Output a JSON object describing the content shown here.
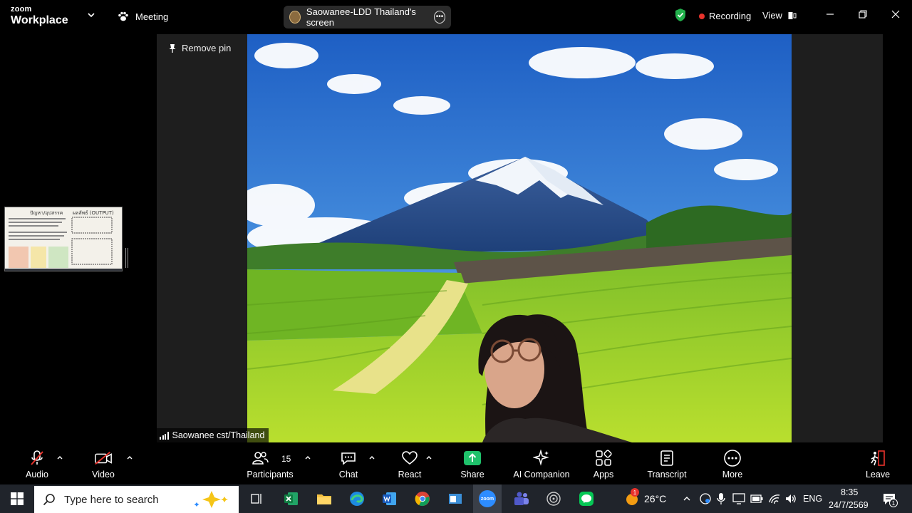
{
  "titlebar": {
    "brand_top": "zoom",
    "brand_bottom": "Workplace",
    "meeting_label": "Meeting",
    "screen_share_label": "Saowanee-LDD Thailand's screen",
    "recording_label": "Recording",
    "view_label": "View"
  },
  "stage": {
    "remove_pin_label": "Remove pin",
    "participant_name": "Saowanee cst/Thailand",
    "thumbnail_heading_left": "ปัญหา/อุปสรรค",
    "thumbnail_heading_right": "ผลลัพธ์ (OUTPUT)"
  },
  "toolbar": {
    "audio": "Audio",
    "video": "Video",
    "participants": "Participants",
    "participants_count": "15",
    "chat": "Chat",
    "react": "React",
    "share": "Share",
    "ai_companion": "AI Companion",
    "apps": "Apps",
    "transcript": "Transcript",
    "more": "More",
    "leave": "Leave"
  },
  "taskbar": {
    "search_placeholder": "Type here to search",
    "zoom_app_label": "zoom",
    "weather_badge": "1",
    "temperature": "26°C",
    "language": "ENG",
    "time": "8:35",
    "date": "24/7/2569",
    "notification_count": "1"
  },
  "colors": {
    "recording_dot": "#e8332c",
    "shield_green": "#22b14c",
    "share_green": "#1fc16b",
    "toolbar_bg": "#000000",
    "taskbar_bg": "#20242b"
  }
}
